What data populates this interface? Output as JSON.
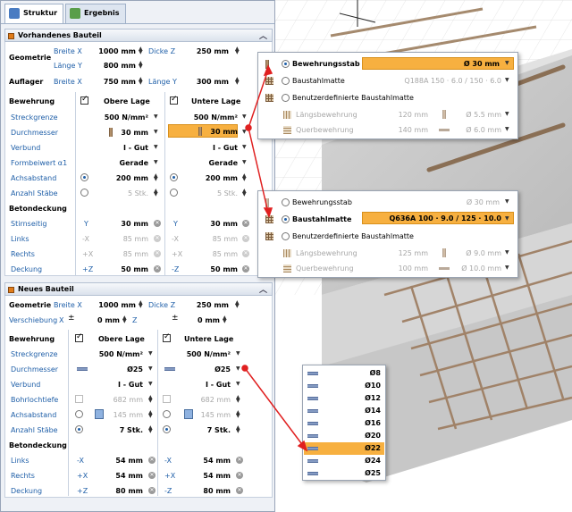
{
  "tabs": [
    "Struktur",
    "Ergebnis"
  ],
  "colors": {
    "accent": "#f7b040",
    "link": "#1f5fa8",
    "arrow": "#e02020"
  },
  "vorhanden": {
    "title": "Vorhandenes Bauteil",
    "geometrie": "Geometrie",
    "breite_x": "Breite X",
    "breite_x_val": "1000 mm",
    "dicke_z": "Dicke Z",
    "dicke_z_val": "250 mm",
    "laenge_y": "Länge Y",
    "laenge_y_val": "800 mm",
    "auflager": "Auflager",
    "auflager_breite": "Breite X",
    "auflager_breite_val": "750 mm",
    "auflager_laenge": "Länge Y",
    "auflager_laenge_val": "300 mm",
    "bewehrung": "Bewehrung",
    "obere": "Obere Lage",
    "untere": "Untere Lage",
    "rows": [
      {
        "label": "Streckgrenze",
        "o": "500 N/mm²",
        "u": "500 N/mm²"
      },
      {
        "label": "Durchmesser",
        "o": "30 mm",
        "u": "30 mm"
      },
      {
        "label": "Verbund",
        "o": "I - Gut",
        "u": "I - Gut"
      },
      {
        "label": "Formbeiwert α1",
        "o": "Gerade",
        "u": "Gerade"
      },
      {
        "label": "Achsabstand",
        "o": "200 mm",
        "u": "200 mm"
      },
      {
        "label": "Anzahl Stäbe",
        "o": "5 Stk.",
        "u": "5 Stk."
      }
    ],
    "betondeckung": "Betondeckung",
    "deck": [
      {
        "label": "Stirnseitig",
        "ox": "Y",
        "o": "30 mm",
        "ux": "Y",
        "u": "30 mm"
      },
      {
        "label": "Links",
        "ox": "-X",
        "o": "85 mm",
        "ux": "-X",
        "u": "85 mm"
      },
      {
        "label": "Rechts",
        "ox": "+X",
        "o": "85 mm",
        "ux": "+X",
        "u": "85 mm"
      },
      {
        "label": "Deckung",
        "ox": "+Z",
        "o": "50 mm",
        "ux": "-Z",
        "u": "50 mm"
      }
    ]
  },
  "neu": {
    "title": "Neues Bauteil",
    "geometrie": "Geometrie",
    "breite_x": "Breite X",
    "breite_x_val": "1000 mm",
    "dicke_z": "Dicke Z",
    "dicke_z_val": "250 mm",
    "verschiebung": "Verschiebung",
    "vx": "X",
    "vx_val": "0 mm",
    "vz": "Z",
    "vz_val": "0 mm",
    "bewehrung": "Bewehrung",
    "obere": "Obere Lage",
    "untere": "Untere Lage",
    "rows": [
      {
        "label": "Streckgrenze",
        "o": "500 N/mm²",
        "u": "500 N/mm²"
      },
      {
        "label": "Durchmesser",
        "o": "Ø25",
        "u": "Ø25"
      },
      {
        "label": "Verbund",
        "o": "I - Gut",
        "u": "I - Gut"
      },
      {
        "label": "Bohrlochtiefe",
        "o": "682 mm",
        "u": "682 mm"
      },
      {
        "label": "Achsabstand",
        "o": "145 mm",
        "u": "145 mm"
      },
      {
        "label": "Anzahl Stäbe",
        "o": "7 Stk.",
        "u": "7 Stk."
      }
    ],
    "betondeckung": "Betondeckung",
    "deck": [
      {
        "label": "Links",
        "ox": "-X",
        "o": "54 mm",
        "ux": "-X",
        "u": "54 mm"
      },
      {
        "label": "Rechts",
        "ox": "+X",
        "o": "54 mm",
        "ux": "+X",
        "u": "54 mm"
      },
      {
        "label": "Deckung",
        "ox": "+Z",
        "o": "80 mm",
        "ux": "-Z",
        "u": "80 mm"
      }
    ]
  },
  "pop1": {
    "r1": "Bewehrungsstab",
    "r1v": "Ø 30 mm",
    "r2": "Baustahlmatte",
    "r2v": "Q188A 150 · 6.0 / 150 · 6.0",
    "r3": "Benutzerdefinierte Baustahlmatte",
    "r4": "Längsbewehrung",
    "r4a": "120 mm",
    "r4b": "Ø 5.5 mm",
    "r5": "Querbewehrung",
    "r5a": "140 mm",
    "r5b": "Ø 6.0 mm"
  },
  "pop2": {
    "r1": "Bewehrungsstab",
    "r1v": "Ø 30 mm",
    "r2": "Baustahlmatte",
    "r2v": "Q636A 100 · 9.0 / 125 · 10.0",
    "r3": "Benutzerdefinierte Baustahlmatte",
    "r4": "Längsbewehrung",
    "r4a": "125 mm",
    "r4b": "Ø 9.0 mm",
    "r5": "Querbewehrung",
    "r5a": "100 mm",
    "r5b": "Ø 10.0 mm"
  },
  "dropdown": [
    "Ø8",
    "Ø10",
    "Ø12",
    "Ø14",
    "Ø16",
    "Ø20",
    "Ø22",
    "Ø24",
    "Ø25"
  ],
  "dropdown_selected": "Ø22"
}
